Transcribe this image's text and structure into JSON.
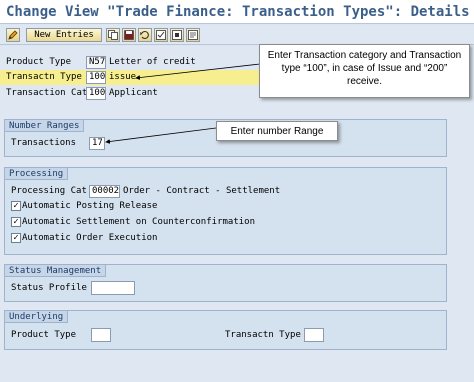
{
  "window": {
    "title": "Change View \"Trade Finance: Transaction Types\": Details"
  },
  "toolbar": {
    "new_entries_label": "New Entries",
    "icons": [
      "edit-pencil-icon",
      "copy-icon",
      "save-icon",
      "undo-icon",
      "select-all-icon",
      "deselect-icon",
      "print-icon"
    ]
  },
  "header_fields": {
    "product_type": {
      "label": "Product Type",
      "value": "N57",
      "description": "Letter of credit"
    },
    "transaction_type": {
      "label": "Transactn Type",
      "value": "100",
      "description": "issue"
    },
    "transaction_cat": {
      "label": "Transaction Cat",
      "value": "100",
      "description": "Applicant"
    }
  },
  "number_ranges": {
    "title": "Number Ranges",
    "transactions_label": "Transactions",
    "transactions_value": "17"
  },
  "processing": {
    "title": "Processing",
    "processing_cat_label": "Processing Cat.",
    "processing_cat_value": "00002",
    "processing_cat_desc": "Order - Contract - Settlement",
    "options": [
      {
        "label": "Automatic Posting Release",
        "checked": true
      },
      {
        "label": "Automatic Settlement on Counterconfirmation",
        "checked": true
      },
      {
        "label": "Automatic Order Execution",
        "checked": true
      }
    ]
  },
  "status_management": {
    "title": "Status Management",
    "status_profile_label": "Status Profile",
    "status_profile_value": ""
  },
  "underlying": {
    "title": "Underlying",
    "product_type_label": "Product Type",
    "product_type_value": "",
    "transactn_type_label": "Transactn Type",
    "transactn_type_value": ""
  },
  "callouts": {
    "transaction_callout": "Enter Transaction category and Transaction type “100”, in case of Issue and “200” receive.",
    "number_range_callout": "Enter number Range"
  },
  "colors": {
    "title_text": "#3b5f8a",
    "panel_bg": "#dfe8f2",
    "highlight": "#f7ee8f"
  }
}
